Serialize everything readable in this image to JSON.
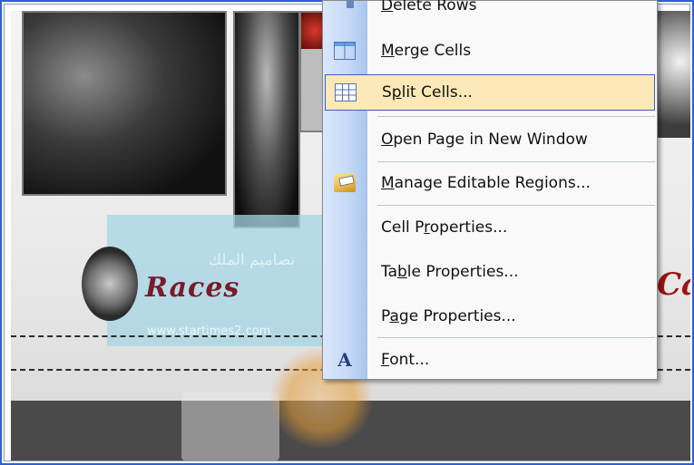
{
  "page": {
    "logo_text": "Races",
    "logo_url": "www.startimes2.com",
    "arabic_text": "تصاميم الملك",
    "right_partial_text": "Ca"
  },
  "context_menu": {
    "items": [
      {
        "pre": "",
        "acc": "D",
        "post": "elete Rows",
        "icon": "delete-rows-icon"
      },
      {
        "pre": "",
        "acc": "M",
        "post": "erge Cells",
        "icon": "merge-cells-icon"
      },
      {
        "pre": "S",
        "acc": "p",
        "post": "lit Cells...",
        "icon": "split-cells-icon",
        "highlighted": true
      },
      {
        "pre": "",
        "acc": "O",
        "post": "pen Page in New Window",
        "icon": ""
      },
      {
        "pre": "",
        "acc": "M",
        "post": "anage Editable Regions...",
        "icon": "editable-regions-icon"
      },
      {
        "pre": "Cell P",
        "acc": "r",
        "post": "operties...",
        "icon": ""
      },
      {
        "pre": "Ta",
        "acc": "b",
        "post": "le Properties...",
        "icon": ""
      },
      {
        "pre": "P",
        "acc": "a",
        "post": "ge Properties...",
        "icon": ""
      },
      {
        "pre": "",
        "acc": "F",
        "post": "ont...",
        "icon": "font-icon",
        "icon_glyph": "A"
      }
    ]
  },
  "colors": {
    "menu_highlight": "#fde9b7",
    "menu_highlight_border": "#3a60b7",
    "frame_border": "#2f5fd0"
  }
}
